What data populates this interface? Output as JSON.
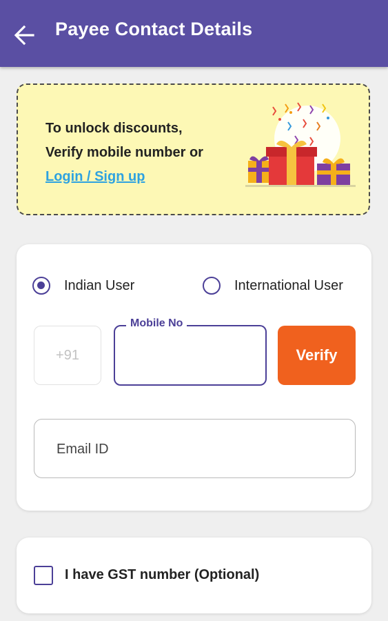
{
  "header": {
    "title": "Payee Contact Details"
  },
  "promo": {
    "line1": "To unlock discounts,",
    "line2": "Verify mobile number or",
    "link": "Login / Sign up"
  },
  "user_type": {
    "options": [
      {
        "label": "Indian User",
        "selected": true
      },
      {
        "label": "International User",
        "selected": false
      }
    ]
  },
  "phone": {
    "country_code": "+91",
    "label": "Mobile No",
    "value": "",
    "verify_label": "Verify"
  },
  "email": {
    "placeholder": "Email ID",
    "value": ""
  },
  "gst": {
    "label": "I have GST number (Optional)",
    "checked": false
  },
  "colors": {
    "primary": "#5a4fa3",
    "accent": "#f0611e",
    "promo_bg": "#fdf8b5",
    "link": "#2ea2e0"
  }
}
